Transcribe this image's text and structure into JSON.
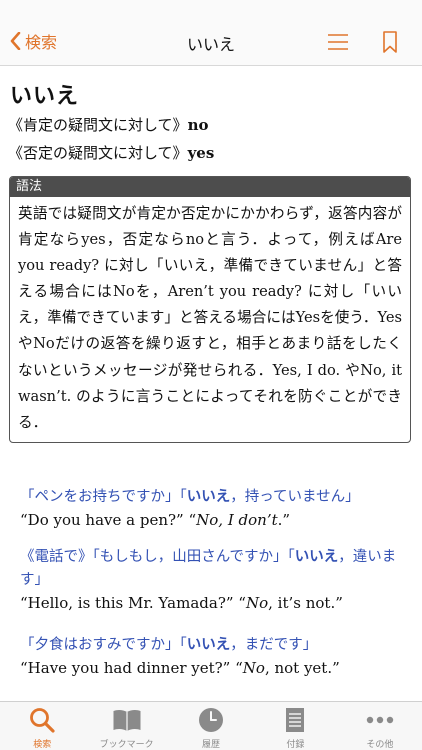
{
  "nav": {
    "back_label": "検索",
    "title": "いいえ",
    "accent_color": "#e0752c"
  },
  "entry": {
    "headword": "いいえ",
    "senses": [
      {
        "qualifier": "《肯定の疑問文に対して》",
        "word": "no"
      },
      {
        "qualifier": "《否定の疑問文に対して》",
        "word": "yes"
      }
    ],
    "usage_note": {
      "title": "語法",
      "text": "英語では疑問文が肯定か否定かにかかわらず，返答内容が肯定ならyes，否定ならnoと言う．よって，例えばAre you ready? に対し「いいえ，準備できていません」と答える場合にはNoを，Aren’t you ready? に対し「いいえ，準備できています」と答える場合にはYesを使う．YesやNoだけの返答を繰り返すと，相手とあまり話をしたくないというメッセージが発せられる．Yes, I do. やNo, it wasn’t. のように言うことによってそれを防ぐことができる．"
    },
    "examples": [
      {
        "ja_prefix": "「ペンをお持ちですか」「",
        "ja_keyword": "いいえ",
        "ja_suffix": "，持っていません」",
        "en_prefix": "“Do you have a pen?” “",
        "en_italic": "No, I don’t",
        "en_suffix": ".”"
      },
      {
        "ja_prefix": "《電話で》「もしもし，山田さんですか」「",
        "ja_keyword": "いいえ",
        "ja_suffix": "，違います」",
        "en_prefix": "“Hello, is this Mr. Yamada?” “",
        "en_italic": "No",
        "en_suffix": ", it’s not.”"
      },
      {
        "ja_prefix": "「夕食はおすみですか」「",
        "ja_keyword": "いいえ",
        "ja_suffix": "，まだです」",
        "en_prefix": "“Have you had dinner yet?” “",
        "en_italic": "No",
        "en_suffix": ", not yet.”"
      }
    ]
  },
  "tabs": [
    {
      "label": "検索",
      "icon": "search-icon",
      "active": true
    },
    {
      "label": "ブックマーク",
      "icon": "book-icon",
      "active": false
    },
    {
      "label": "履歴",
      "icon": "clock-icon",
      "active": false
    },
    {
      "label": "付録",
      "icon": "document-icon",
      "active": false
    },
    {
      "label": "その他",
      "icon": "more-icon",
      "active": false
    }
  ]
}
